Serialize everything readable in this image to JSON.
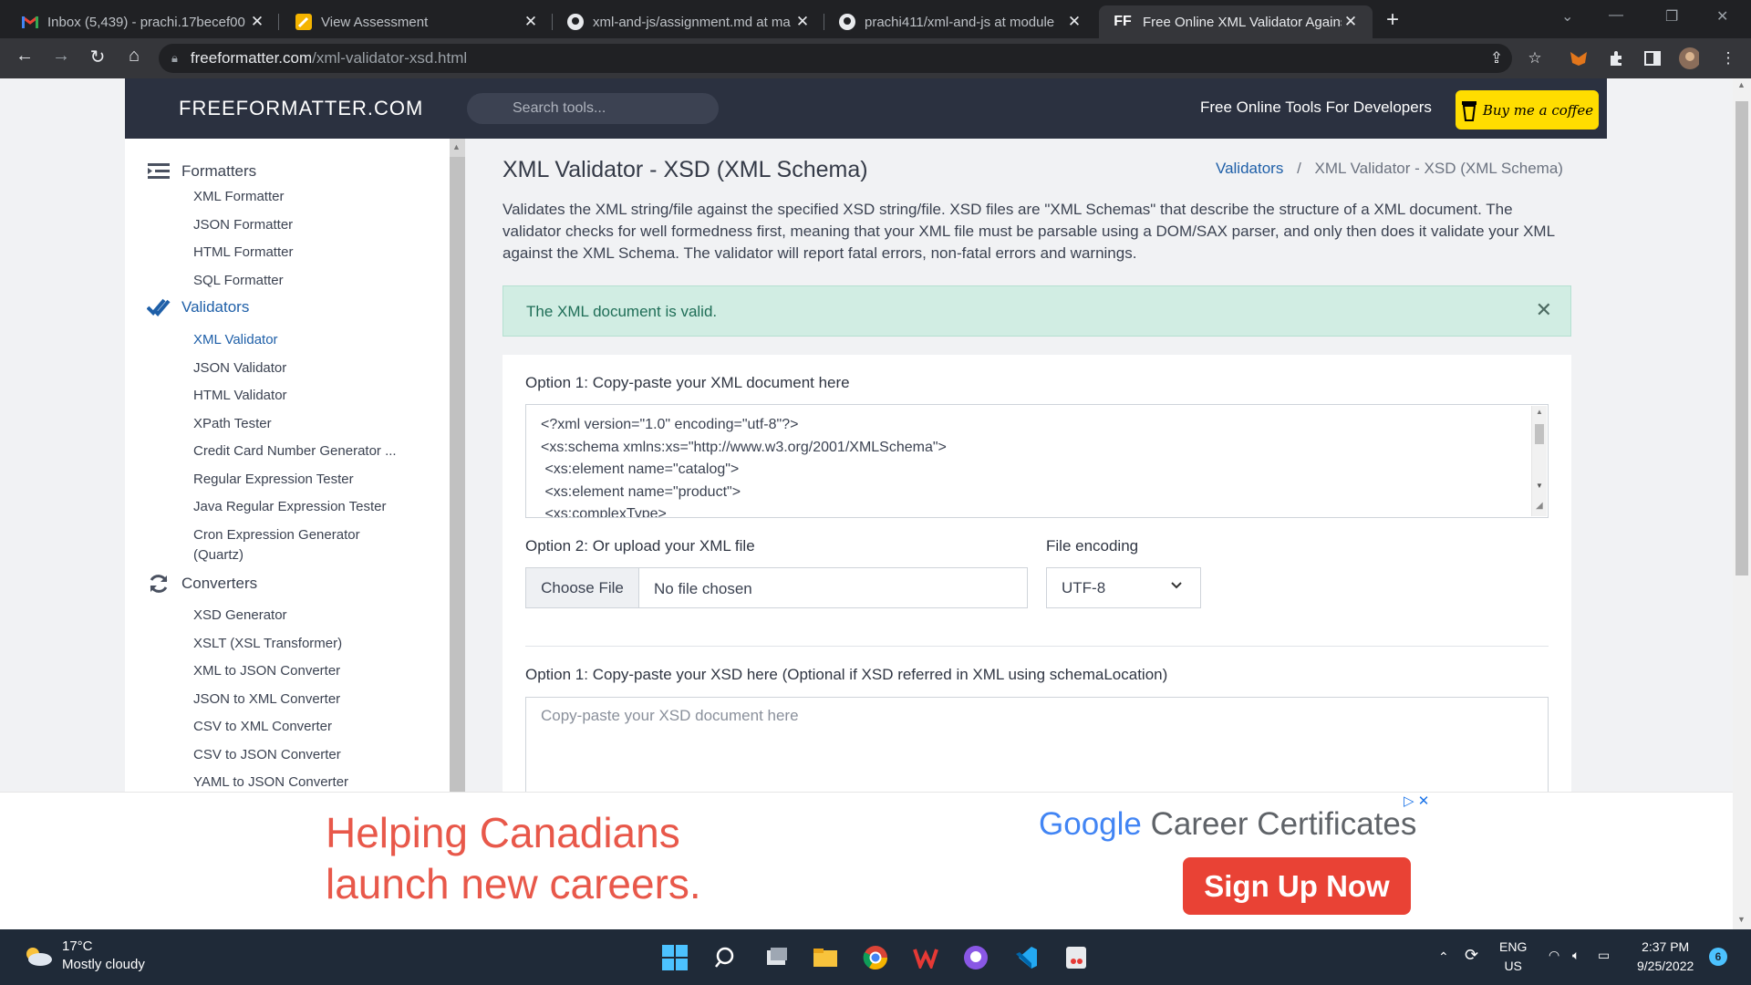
{
  "browser": {
    "tabs": [
      {
        "title": "Inbox (5,439) - prachi.17becef00",
        "icon": "gmail-icon"
      },
      {
        "title": "View Assessment",
        "icon": "pencil-icon"
      },
      {
        "title": "xml-and-js/assignment.md at ma",
        "icon": "github-icon"
      },
      {
        "title": "prachi411/xml-and-js at module",
        "icon": "github-icon"
      },
      {
        "title": "Free Online XML Validator Agains",
        "icon": "ff-icon",
        "active": true
      }
    ],
    "favicon_ff": "FF",
    "url_host": "freeformatter.com",
    "url_path": "/xml-validator-xsd.html"
  },
  "header": {
    "logo": "FREEFORMATTER.COM",
    "search_placeholder": "Search tools...",
    "tagline": "Free Online Tools For Developers",
    "coffee_label": "Buy me a coffee"
  },
  "sidebar": {
    "categories": [
      {
        "label": "Formatters",
        "icon": "list-indent-icon"
      },
      {
        "label": "Validators",
        "icon": "double-check-icon"
      },
      {
        "label": "Converters",
        "icon": "refresh-icon"
      }
    ],
    "formatters": [
      "XML Formatter",
      "JSON Formatter",
      "HTML Formatter",
      "SQL Formatter"
    ],
    "validators": [
      "XML Validator",
      "JSON Validator",
      "HTML Validator",
      "XPath Tester",
      "Credit Card Number Generator ...",
      "Regular Expression Tester",
      "Java Regular Expression Tester",
      "Cron Expression Generator",
      "(Quartz)"
    ],
    "converters": [
      "XSD Generator",
      "XSLT (XSL Transformer)",
      "XML to JSON Converter",
      "JSON to XML Converter",
      "CSV to XML Converter",
      "CSV to JSON Converter",
      "YAML to JSON Converter"
    ]
  },
  "main": {
    "title": "XML Validator - XSD (XML Schema)",
    "breadcrumb": {
      "link": "Validators",
      "sep": "/",
      "current": "XML Validator - XSD (XML Schema)"
    },
    "description": "Validates the XML string/file against the specified XSD string/file. XSD files are \"XML Schemas\" that describe the structure of a XML document. The validator checks for well formedness first, meaning that your XML file must be parsable using a DOM/SAX parser, and only then does it validate your XML against the XML Schema. The validator will report fatal errors, non-fatal errors and warnings.",
    "alert": "The XML document is valid.",
    "xml_label": "Option 1: Copy-paste your XML document here",
    "xml_lines": [
      "<?xml version=\"1.0\" encoding=\"utf-8\"?>",
      "<xs:schema xmlns:xs=\"http://www.w3.org/2001/XMLSchema\">",
      " <xs:element name=\"catalog\">",
      " <xs:element name=\"product\">",
      " <xs:complexType>"
    ],
    "upload_label": "Option 2: Or upload your XML file",
    "choose_file": "Choose File",
    "no_file": "No file chosen",
    "encoding_label": "File encoding",
    "encoding_value": "UTF-8",
    "xsd_label": "Option 1: Copy-paste your XSD here (Optional if XSD referred in XML using schemaLocation)",
    "xsd_placeholder": "Copy-paste your XSD document here"
  },
  "ad": {
    "headline_1": "Helping Canadians",
    "headline_2": "launch new careers.",
    "brand_google": "Google",
    "brand_rest": " Career Certificates",
    "cta": "Sign Up Now",
    "adchoices": "▷ ✕"
  },
  "taskbar": {
    "temp": "17°C",
    "weather": "Mostly cloudy",
    "lang": "ENG",
    "region": "US",
    "time": "2:37 PM",
    "date": "9/25/2022",
    "notifications": "6"
  }
}
